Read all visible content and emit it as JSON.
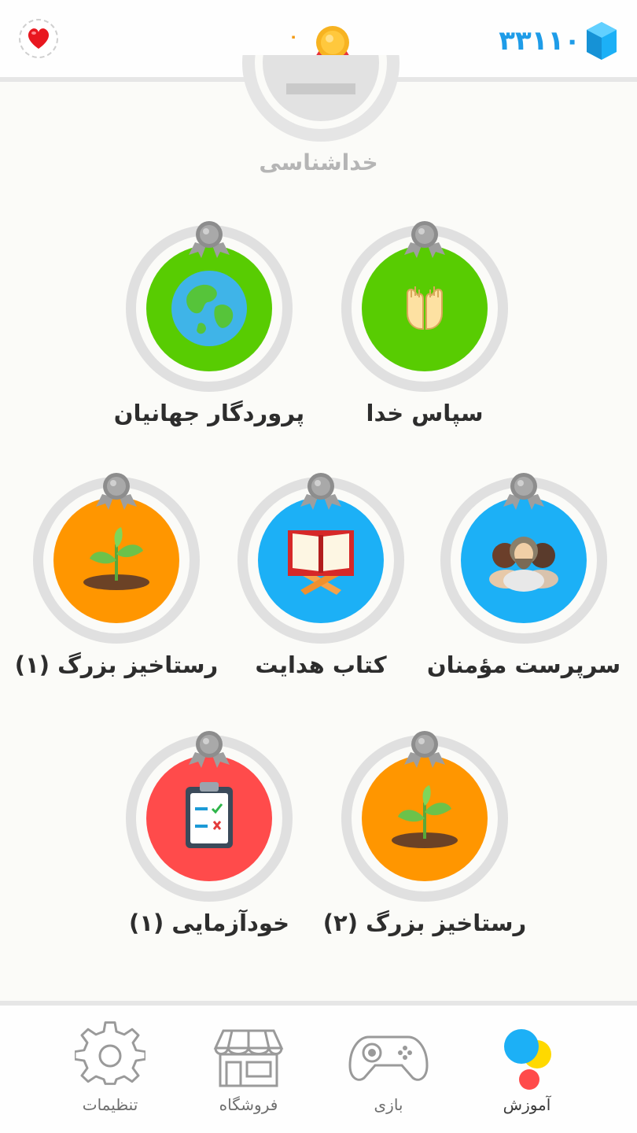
{
  "header": {
    "gems_count": "۳۳۱۱۰",
    "medal_count": "۰",
    "icons": {
      "heart": "heart-icon",
      "medal": "medal-icon",
      "gem": "gem-icon"
    }
  },
  "path": {
    "previous_unit_label": "خداشناسی",
    "nodes": [
      {
        "label": "سپاس خدا",
        "color": "#58cc02",
        "icon": "praying-hands-icon"
      },
      {
        "label": "پروردگار جهانیان",
        "color": "#58cc02",
        "icon": "globe-icon"
      },
      {
        "label": "سرپرست مؤمنان",
        "color": "#1cb0f6",
        "icon": "people-icon"
      },
      {
        "label": "کتاب هدایت",
        "color": "#1cb0f6",
        "icon": "book-icon"
      },
      {
        "label": "رستاخیز بزرگ (۱)",
        "color": "#ff9600",
        "icon": "sprout-icon"
      },
      {
        "label": "رستاخیز بزرگ (۲)",
        "color": "#ff9600",
        "icon": "sprout-icon"
      },
      {
        "label": "خودآزمایی (۱)",
        "color": "#ff4b4b",
        "icon": "clipboard-icon"
      }
    ]
  },
  "nav": {
    "tabs": [
      {
        "label": "آموزش",
        "icon": "learn-icon",
        "active": true
      },
      {
        "label": "بازی",
        "icon": "gamepad-icon",
        "active": false
      },
      {
        "label": "فروشگاه",
        "icon": "shop-icon",
        "active": false
      },
      {
        "label": "تنظیمات",
        "icon": "gear-icon",
        "active": false
      }
    ]
  }
}
